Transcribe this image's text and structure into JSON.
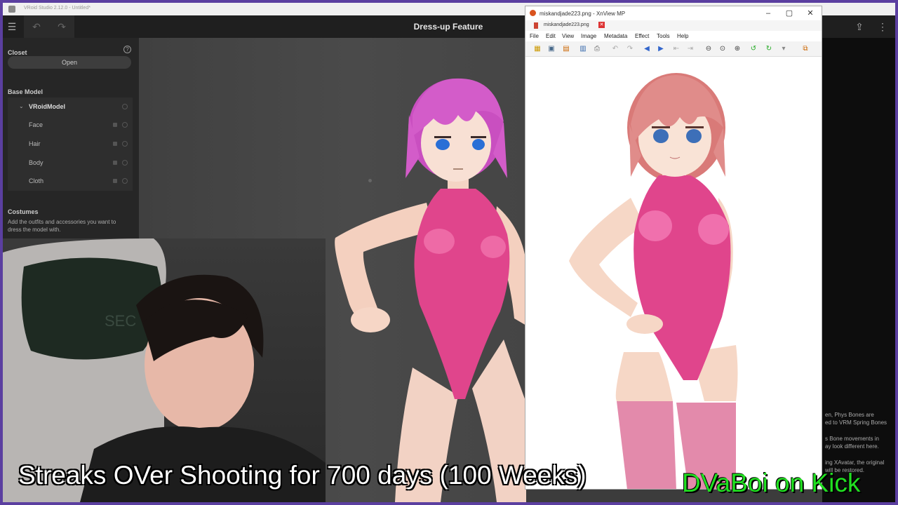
{
  "vroid": {
    "window_title": "VRoid Studio 2.12.0 - Untitled*",
    "page_title": "Dress-up Feature",
    "closet_title": "Closet",
    "open_label": "Open",
    "base_model_title": "Base Model",
    "tree": [
      {
        "label": "VRoidModel",
        "root": true
      },
      {
        "label": "Face"
      },
      {
        "label": "Hair"
      },
      {
        "label": "Body"
      },
      {
        "label": "Cloth"
      }
    ],
    "costumes_title": "Costumes",
    "costumes_desc": "Add the outfits and accessories you want to dress the model with.",
    "right_notes": [
      "en, Phys Bones are",
      "ed to VRM Spring Bones",
      "s Bone movements in",
      "ay look different here.",
      "ing XAvatar, the original",
      "will be restored."
    ]
  },
  "xnview": {
    "window_title": "miskandjade223.png - XnView MP",
    "tab_label": "miskandjade223.png",
    "menu": [
      "File",
      "Edit",
      "View",
      "Image",
      "Metadata",
      "Effect",
      "Tools",
      "Help"
    ]
  },
  "overlay": {
    "ticker": "Streaks OVer Shooting for 700 days (100 Weeks)",
    "brand": "DVaBoi on Kick"
  },
  "colors": {
    "frame": "#5b3fa0",
    "brand": "#21e021",
    "swimsuit": "#e0458c",
    "hair_vroid": "#d35cc9",
    "hair_xn": "#e08c8a"
  }
}
